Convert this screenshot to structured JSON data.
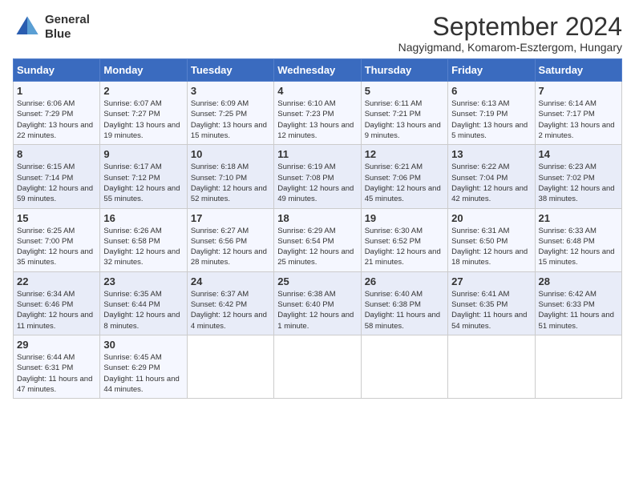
{
  "header": {
    "logo_line1": "General",
    "logo_line2": "Blue",
    "title": "September 2024",
    "subtitle": "Nagyigmand, Komarom-Esztergom, Hungary"
  },
  "days_of_week": [
    "Sunday",
    "Monday",
    "Tuesday",
    "Wednesday",
    "Thursday",
    "Friday",
    "Saturday"
  ],
  "weeks": [
    [
      {
        "day": 1,
        "sunrise": "6:06 AM",
        "sunset": "7:29 PM",
        "daylight": "13 hours and 22 minutes."
      },
      {
        "day": 2,
        "sunrise": "6:07 AM",
        "sunset": "7:27 PM",
        "daylight": "13 hours and 19 minutes."
      },
      {
        "day": 3,
        "sunrise": "6:09 AM",
        "sunset": "7:25 PM",
        "daylight": "13 hours and 15 minutes."
      },
      {
        "day": 4,
        "sunrise": "6:10 AM",
        "sunset": "7:23 PM",
        "daylight": "13 hours and 12 minutes."
      },
      {
        "day": 5,
        "sunrise": "6:11 AM",
        "sunset": "7:21 PM",
        "daylight": "13 hours and 9 minutes."
      },
      {
        "day": 6,
        "sunrise": "6:13 AM",
        "sunset": "7:19 PM",
        "daylight": "13 hours and 5 minutes."
      },
      {
        "day": 7,
        "sunrise": "6:14 AM",
        "sunset": "7:17 PM",
        "daylight": "13 hours and 2 minutes."
      }
    ],
    [
      {
        "day": 8,
        "sunrise": "6:15 AM",
        "sunset": "7:14 PM",
        "daylight": "12 hours and 59 minutes."
      },
      {
        "day": 9,
        "sunrise": "6:17 AM",
        "sunset": "7:12 PM",
        "daylight": "12 hours and 55 minutes."
      },
      {
        "day": 10,
        "sunrise": "6:18 AM",
        "sunset": "7:10 PM",
        "daylight": "12 hours and 52 minutes."
      },
      {
        "day": 11,
        "sunrise": "6:19 AM",
        "sunset": "7:08 PM",
        "daylight": "12 hours and 49 minutes."
      },
      {
        "day": 12,
        "sunrise": "6:21 AM",
        "sunset": "7:06 PM",
        "daylight": "12 hours and 45 minutes."
      },
      {
        "day": 13,
        "sunrise": "6:22 AM",
        "sunset": "7:04 PM",
        "daylight": "12 hours and 42 minutes."
      },
      {
        "day": 14,
        "sunrise": "6:23 AM",
        "sunset": "7:02 PM",
        "daylight": "12 hours and 38 minutes."
      }
    ],
    [
      {
        "day": 15,
        "sunrise": "6:25 AM",
        "sunset": "7:00 PM",
        "daylight": "12 hours and 35 minutes."
      },
      {
        "day": 16,
        "sunrise": "6:26 AM",
        "sunset": "6:58 PM",
        "daylight": "12 hours and 32 minutes."
      },
      {
        "day": 17,
        "sunrise": "6:27 AM",
        "sunset": "6:56 PM",
        "daylight": "12 hours and 28 minutes."
      },
      {
        "day": 18,
        "sunrise": "6:29 AM",
        "sunset": "6:54 PM",
        "daylight": "12 hours and 25 minutes."
      },
      {
        "day": 19,
        "sunrise": "6:30 AM",
        "sunset": "6:52 PM",
        "daylight": "12 hours and 21 minutes."
      },
      {
        "day": 20,
        "sunrise": "6:31 AM",
        "sunset": "6:50 PM",
        "daylight": "12 hours and 18 minutes."
      },
      {
        "day": 21,
        "sunrise": "6:33 AM",
        "sunset": "6:48 PM",
        "daylight": "12 hours and 15 minutes."
      }
    ],
    [
      {
        "day": 22,
        "sunrise": "6:34 AM",
        "sunset": "6:46 PM",
        "daylight": "12 hours and 11 minutes."
      },
      {
        "day": 23,
        "sunrise": "6:35 AM",
        "sunset": "6:44 PM",
        "daylight": "12 hours and 8 minutes."
      },
      {
        "day": 24,
        "sunrise": "6:37 AM",
        "sunset": "6:42 PM",
        "daylight": "12 hours and 4 minutes."
      },
      {
        "day": 25,
        "sunrise": "6:38 AM",
        "sunset": "6:40 PM",
        "daylight": "12 hours and 1 minute."
      },
      {
        "day": 26,
        "sunrise": "6:40 AM",
        "sunset": "6:38 PM",
        "daylight": "11 hours and 58 minutes."
      },
      {
        "day": 27,
        "sunrise": "6:41 AM",
        "sunset": "6:35 PM",
        "daylight": "11 hours and 54 minutes."
      },
      {
        "day": 28,
        "sunrise": "6:42 AM",
        "sunset": "6:33 PM",
        "daylight": "11 hours and 51 minutes."
      }
    ],
    [
      {
        "day": 29,
        "sunrise": "6:44 AM",
        "sunset": "6:31 PM",
        "daylight": "11 hours and 47 minutes."
      },
      {
        "day": 30,
        "sunrise": "6:45 AM",
        "sunset": "6:29 PM",
        "daylight": "11 hours and 44 minutes."
      },
      null,
      null,
      null,
      null,
      null
    ]
  ]
}
